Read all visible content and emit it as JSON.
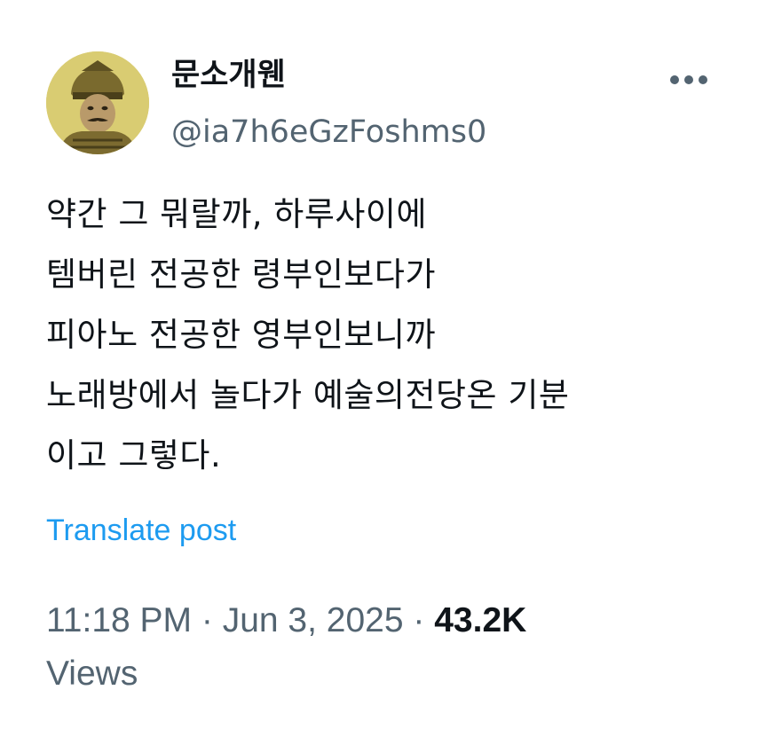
{
  "author": {
    "display_name": "문소개웬",
    "handle": "@ia7h6eGzFoshms0"
  },
  "post": {
    "lines": [
      "약간 그 뭐랄까, 하루사이에",
      "템버린 전공한 령부인보다가",
      "피아노 전공한 영부인보니까",
      "노래방에서 놀다가 예술의전당온 기분",
      "이고 그렇다."
    ]
  },
  "translate_label": "Translate post",
  "meta": {
    "time": "11:18 PM",
    "separator": " · ",
    "date": "Jun 3, 2025",
    "views_count": "43.2K",
    "views_label": "Views"
  },
  "icons": {
    "more": "more-horizontal-icon",
    "avatar": "portrait-avatar"
  },
  "colors": {
    "text": "#0f1419",
    "secondary": "#536471",
    "link": "#1d9bf0",
    "background": "#ffffff"
  }
}
